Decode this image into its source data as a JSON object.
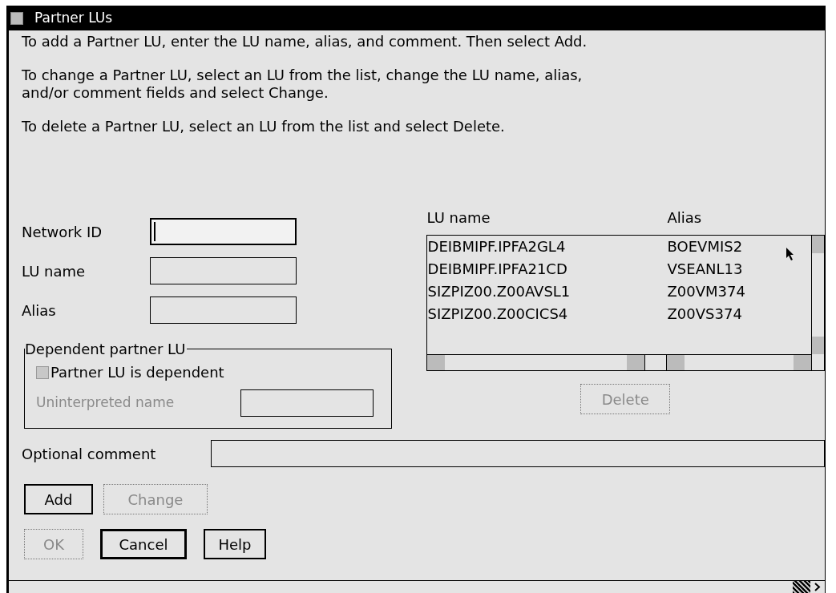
{
  "window": {
    "title": "Partner LUs"
  },
  "instructions": [
    "To add a Partner LU, enter the LU name, alias, and comment.  Then select Add.",
    "To change a Partner LU, select an LU from the list, change the LU name, alias, and/or comment fields and select Change.",
    "To delete a Partner LU, select an LU from the list and select Delete."
  ],
  "fields": [
    {
      "label": "Network ID",
      "focused": true
    },
    {
      "label": "LU name",
      "focused": false
    },
    {
      "label": "Alias",
      "focused": false
    }
  ],
  "dependent_group": {
    "title": "Dependent partner LU",
    "checkbox": {
      "label": "Partner LU is dependent",
      "checked": false
    },
    "uninterpreted": {
      "label": "Uninterpreted name",
      "disabled": true
    }
  },
  "lu_list": {
    "columns": [
      "LU name",
      "Alias"
    ],
    "rows": [
      {
        "lu_name": "DEIBMIPF.IPFA2GL4",
        "alias": "BOEVMIS2",
        "selected": false
      },
      {
        "lu_name": "DEIBMIPF.IPFA21CD",
        "alias": "VSEANL13",
        "selected": false
      },
      {
        "lu_name": "SIZPIZ00.Z00AVSL1",
        "alias": "Z00VM374",
        "selected": false
      },
      {
        "lu_name": "SIZPIZ00.Z00CICS4",
        "alias": "Z00VS374",
        "selected": false
      }
    ]
  },
  "delete_button": {
    "label": "Delete",
    "disabled": true
  },
  "comment": {
    "label": "Optional comment"
  },
  "edit_buttons": [
    {
      "label": "Add",
      "disabled": false
    },
    {
      "label": "Change",
      "disabled": true
    }
  ],
  "dialog_buttons": [
    {
      "label": "OK",
      "disabled": true,
      "default": false
    },
    {
      "label": "Cancel",
      "disabled": false,
      "default": true
    },
    {
      "label": "Help",
      "disabled": false,
      "default": false
    }
  ]
}
